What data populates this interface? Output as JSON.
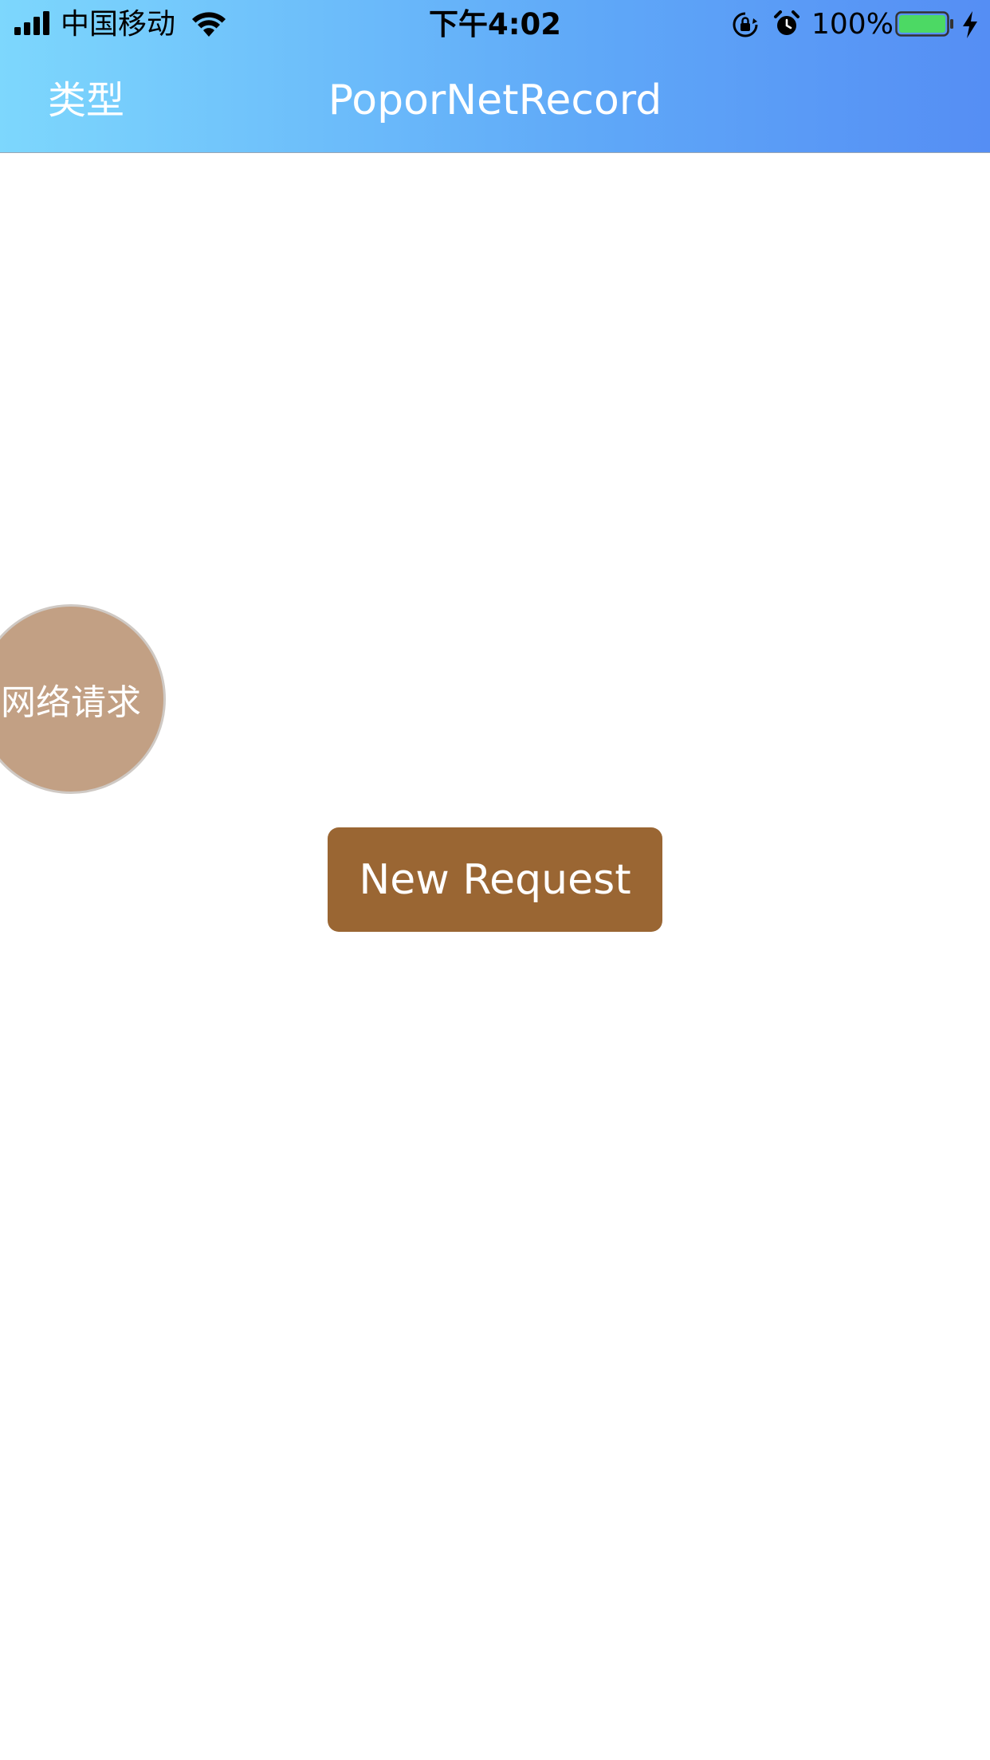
{
  "status_bar": {
    "carrier": "中国移动",
    "time": "下午4:02",
    "battery_percent": "100%",
    "battery_level": 1.0,
    "icons": [
      "signal-icon",
      "wifi-icon",
      "orientation-lock-icon",
      "alarm-icon",
      "battery-icon",
      "charging-icon"
    ]
  },
  "nav_bar": {
    "left_label": "类型",
    "title": "PoporNetRecord",
    "gradient_start": "#7dd7fd",
    "gradient_end": "#558ef4"
  },
  "floating_ball": {
    "label": "网络请求",
    "color": "#c2a084"
  },
  "main": {
    "new_request_label": "New Request",
    "button_color": "#9a6633"
  }
}
